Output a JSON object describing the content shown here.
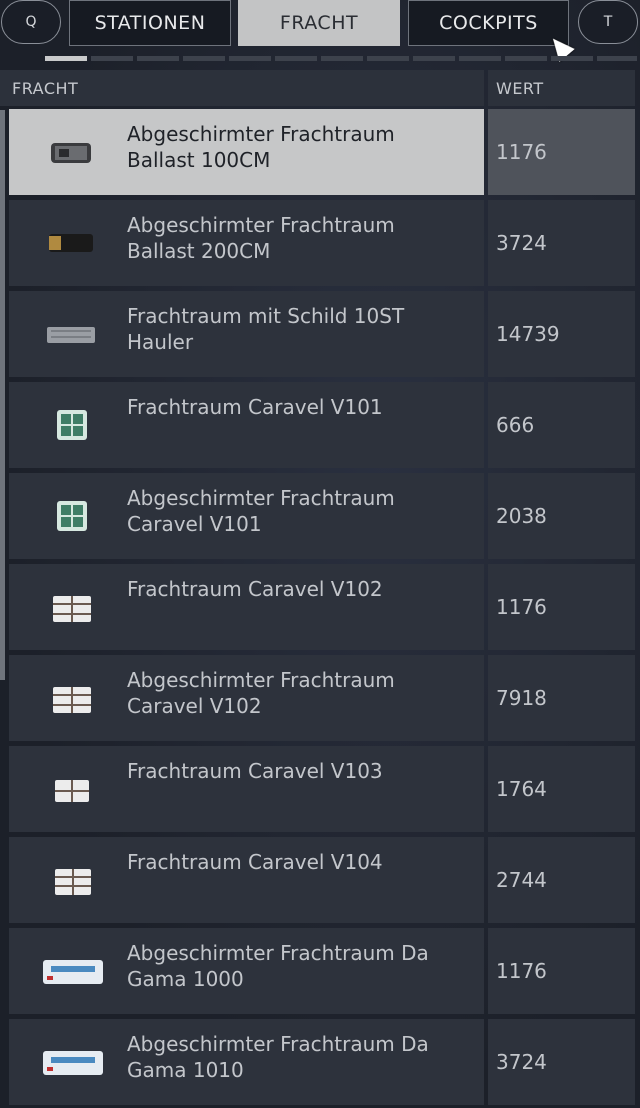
{
  "tabs": {
    "left_key": "Q",
    "right_key": "T",
    "items": [
      {
        "label": "STATIONEN"
      },
      {
        "label": "FRACHT"
      },
      {
        "label": "COCKPITS"
      }
    ]
  },
  "table": {
    "col_name": "FRACHT",
    "col_value": "WERT",
    "rows": [
      {
        "name": "Abgeschirmter Frachtraum\nBallast 100CM",
        "value": "1176"
      },
      {
        "name": "Abgeschirmter Frachtraum\nBallast 200CM",
        "value": "3724"
      },
      {
        "name": "Frachtraum mit Schild 10ST\nHauler",
        "value": "14739"
      },
      {
        "name": "Frachtraum Caravel V101",
        "value": "666"
      },
      {
        "name": "Abgeschirmter Frachtraum\nCaravel V101",
        "value": "2038"
      },
      {
        "name": "Frachtraum Caravel V102",
        "value": "1176"
      },
      {
        "name": "Abgeschirmter Frachtraum\nCaravel V102",
        "value": "7918"
      },
      {
        "name": "Frachtraum Caravel V103",
        "value": "1764"
      },
      {
        "name": "Frachtraum Caravel V104",
        "value": "2744"
      },
      {
        "name": "Abgeschirmter Frachtraum Da\nGama 1000",
        "value": "1176"
      },
      {
        "name": "Abgeschirmter Frachtraum Da\nGama 1010",
        "value": "3724"
      }
    ]
  }
}
